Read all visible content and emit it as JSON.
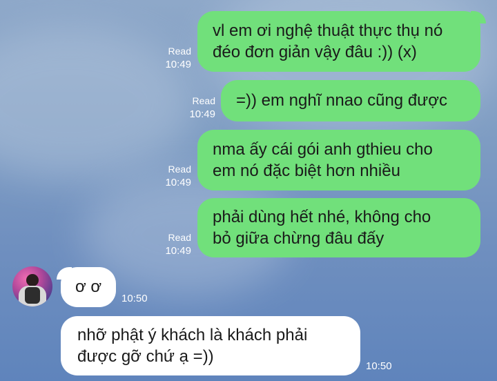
{
  "messages_out": [
    {
      "status": "Read",
      "time": "10:49",
      "lines": [
        "vl em ơi nghệ thuật thực thụ nó",
        "đéo đơn giản vậy đâu :)) (x)"
      ]
    },
    {
      "status": "Read",
      "time": "10:49",
      "lines": [
        "=)) em nghĩ nnao cũng được"
      ]
    },
    {
      "status": "Read",
      "time": "10:49",
      "lines": [
        "nma ấy cái gói anh gthieu cho",
        "em nó đặc biệt hơn nhiều"
      ]
    },
    {
      "status": "Read",
      "time": "10:49",
      "lines": [
        "phải dùng hết nhé, không cho",
        "bỏ giữa chừng đâu đấy"
      ]
    }
  ],
  "messages_in": [
    {
      "time": "10:50",
      "lines": [
        "ơ ơ"
      ]
    },
    {
      "time": "10:50",
      "lines": [
        "nhỡ phật ý khách là khách phải",
        "được gỡ chứ ạ =))"
      ]
    }
  ],
  "colors": {
    "outgoing_bubble": "#71e07b",
    "incoming_bubble": "#ffffff",
    "meta_text": "#ffffff"
  }
}
